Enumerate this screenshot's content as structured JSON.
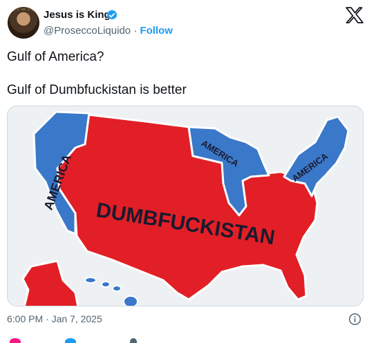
{
  "author": {
    "display_name": "Jesus is King",
    "handle": "@ProseccoLiquido",
    "separator": "·",
    "follow_label": "Follow",
    "verified_color": "#1d9bf0"
  },
  "tweet": {
    "lines": [
      "Gulf of America?",
      "Gulf of Dumbfuckistan is better"
    ],
    "timestamp": "6:00 PM · Jan 7, 2025"
  },
  "media": {
    "labels": {
      "west": "AMERICA",
      "great_lakes": "AMERICA",
      "northeast": "AMERICA",
      "center": "DUMBFUCKISTAN"
    },
    "colors": {
      "blue": "#3a78c9",
      "red": "#e21f26",
      "background": "#eef1f3",
      "text": "#1a1a2e"
    }
  },
  "icons": [
    "verified-badge-icon",
    "x-logo-icon",
    "info-icon"
  ]
}
